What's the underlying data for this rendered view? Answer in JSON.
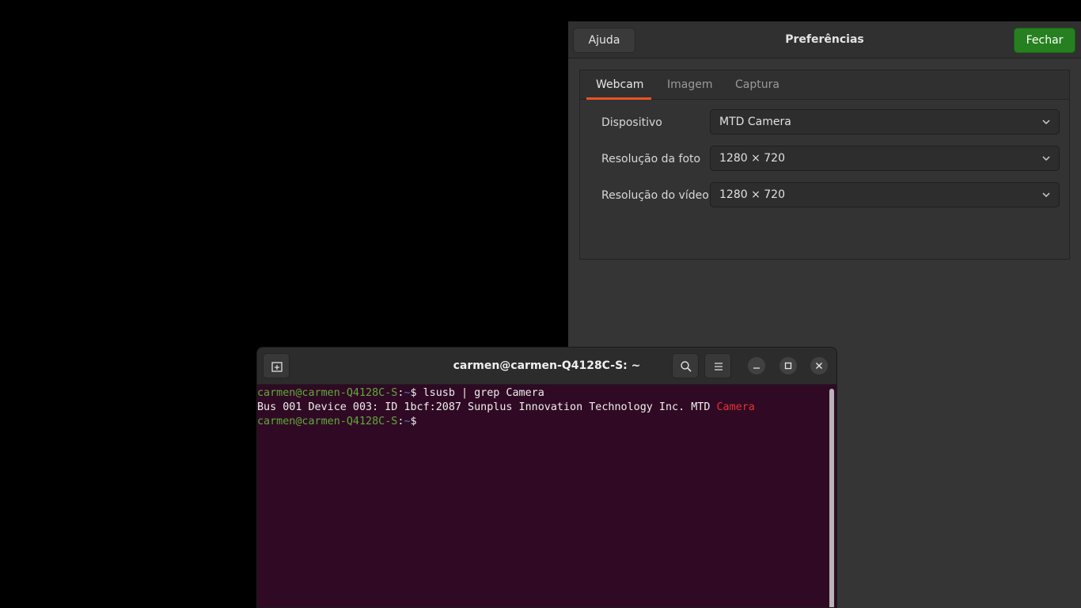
{
  "preferences": {
    "title": "Preferências",
    "help_label": "Ajuda",
    "close_label": "Fechar",
    "tabs": [
      {
        "label": "Webcam",
        "active": true
      },
      {
        "label": "Imagem",
        "active": false
      },
      {
        "label": "Captura",
        "active": false
      }
    ],
    "rows": [
      {
        "label": "Dispositivo",
        "value": "MTD Camera"
      },
      {
        "label": "Resolução da foto",
        "value": "1280 × 720"
      },
      {
        "label": "Resolução do vídeo",
        "value": "1280 × 720"
      }
    ],
    "accent_color": "#e95420",
    "close_button_color": "#26801f"
  },
  "terminal": {
    "title": "carmen@carmen-Q4128C-S: ~",
    "background_color": "#300a24",
    "lines": [
      {
        "user": "carmen@carmen-Q4128C-S",
        "sep": ":",
        "path": "~",
        "prompt": "$ ",
        "command": "lsusb | grep Camera"
      },
      {
        "output": "Bus 001 Device 003: ID 1bcf:2087 Sunplus Innovation Technology Inc. MTD ",
        "highlight": "Camera"
      },
      {
        "user": "carmen@carmen-Q4128C-S",
        "sep": ":",
        "path": "~",
        "prompt": "$",
        "command": ""
      }
    ],
    "icons": {
      "new_tab": "new-tab-icon",
      "search": "search-icon",
      "menu": "hamburger-menu-icon",
      "minimize": "minimize-icon",
      "maximize": "maximize-icon",
      "close": "close-icon"
    }
  }
}
